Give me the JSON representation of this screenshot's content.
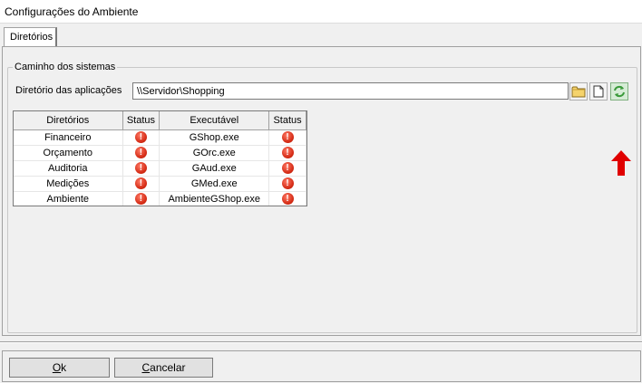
{
  "window": {
    "title": "Configurações do Ambiente"
  },
  "tabs": [
    {
      "label": "Diretórios"
    }
  ],
  "group": {
    "label": "Caminho dos sistemas",
    "dir_label": "Diretório das aplicações",
    "dir_value": "\\\\Servidor\\Shopping"
  },
  "icons": {
    "folder": "folder-icon",
    "file": "file-icon",
    "refresh": "refresh-icon",
    "status": "error-icon",
    "arrow": "arrow-up-icon"
  },
  "table": {
    "headers": [
      "Diretórios",
      "Status",
      "Executável",
      "Status"
    ],
    "rows": [
      {
        "dir": "Financeiro",
        "exe": "GShop.exe"
      },
      {
        "dir": "Orçamento",
        "exe": "GOrc.exe"
      },
      {
        "dir": "Auditoria",
        "exe": "GAud.exe"
      },
      {
        "dir": "Medições",
        "exe": "GMed.exe"
      },
      {
        "dir": "Ambiente",
        "exe": "AmbienteGShop.exe"
      }
    ]
  },
  "buttons": {
    "ok_mnemonic": "O",
    "ok_rest": "k",
    "cancel_mnemonic": "C",
    "cancel_rest": "ancelar"
  },
  "colors": {
    "status_error": "#d42a14",
    "arrow": "#e00000",
    "refresh": "#3a9a3a"
  }
}
